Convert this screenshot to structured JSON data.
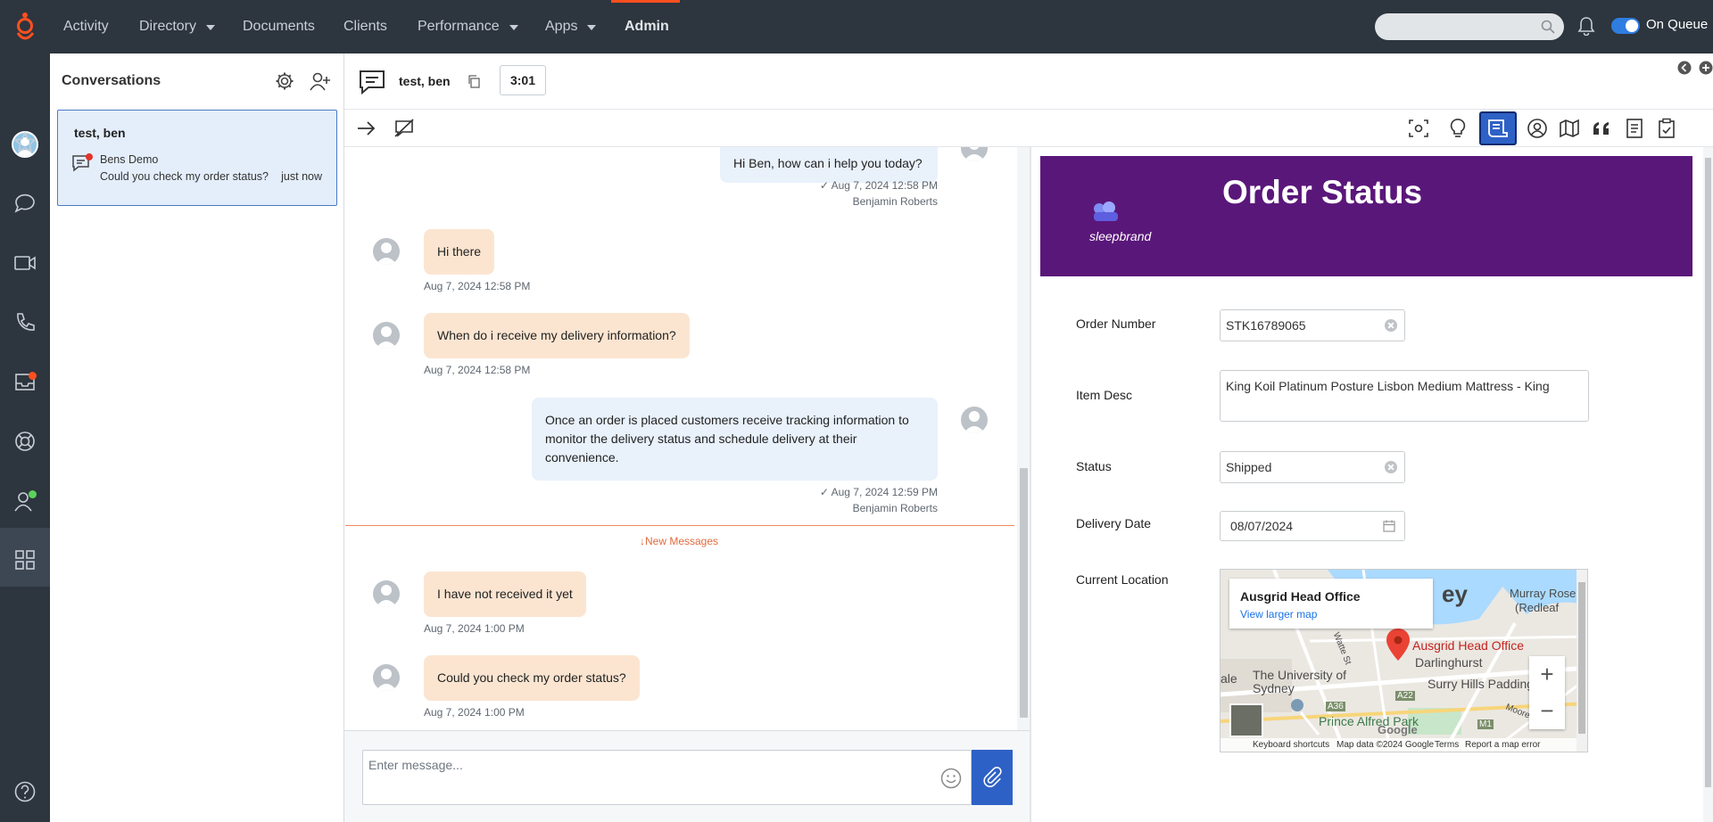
{
  "topbar": {
    "nav": [
      {
        "label": "Activity"
      },
      {
        "label": "Directory"
      },
      {
        "label": "Documents"
      },
      {
        "label": "Clients"
      },
      {
        "label": "Performance"
      },
      {
        "label": "Apps"
      },
      {
        "label": "Admin"
      }
    ],
    "search_placeholder": "",
    "queue_label": "On Queue",
    "accent_color": "#ff4f1f"
  },
  "rail": {
    "icons": [
      "avatar",
      "star-icon",
      "chat-bubble-icon",
      "video-icon",
      "phone-icon",
      "inbox-icon",
      "lifebuoy-icon",
      "user-status-icon",
      "apps-grid-icon",
      "help-icon"
    ]
  },
  "conversations": {
    "title": "Conversations",
    "items": [
      {
        "name": "test, ben",
        "queue": "Bens Demo",
        "preview": "Could you check my order status?",
        "time": "just now"
      }
    ]
  },
  "interaction": {
    "name": "test, ben",
    "timer": "3:01"
  },
  "transcript": {
    "messages": [
      {
        "from": "agent",
        "text": "Hi Ben, how can i help you today?",
        "time": "Aug 7, 2024 12:58 PM",
        "author": "Benjamin Roberts"
      },
      {
        "from": "customer",
        "text": "Hi there",
        "time": "Aug 7, 2024 12:58 PM"
      },
      {
        "from": "customer",
        "text": "When do i receive my delivery information?",
        "time": "Aug 7, 2024 12:58 PM"
      },
      {
        "from": "agent",
        "text": "Once an order is placed customers receive tracking information to monitor the delivery status and schedule delivery at their convenience.",
        "time": "Aug 7, 2024 12:59 PM",
        "author": "Benjamin Roberts"
      },
      {
        "from": "customer",
        "text": "I have not received it yet",
        "time": "Aug 7, 2024 1:00 PM"
      },
      {
        "from": "customer",
        "text": "Could you check my order status?",
        "time": "Aug 7, 2024 1:00 PM"
      }
    ],
    "new_messages_label": "New Messages"
  },
  "composer": {
    "placeholder": "Enter message..."
  },
  "script": {
    "banner_title": "Order Status",
    "brand_name": "sleepbrand",
    "banner_color": "#5a177a",
    "fields": {
      "order_number_label": "Order Number",
      "order_number": "STK16789065",
      "item_desc_label": "Item Desc",
      "item_desc": "King Koil Platinum Posture Lisbon Medium Mattress - King",
      "status_label": "Status",
      "status": "Shipped",
      "delivery_date_label": "Delivery Date",
      "delivery_date": "08/07/2024",
      "location_label": "Current Location"
    },
    "map": {
      "place_title": "Ausgrid Head Office",
      "view_larger": "View larger map",
      "labels": [
        "Ausgrid Head Office",
        "Darlinghurst",
        "The University of Sydney",
        "Surry Hills Paddingto",
        "Prince Alfred Park",
        "Murray Rose",
        "(Redleaf",
        "ey",
        "ale",
        "Watte St",
        "A22",
        "A36",
        "M1",
        "Moore Park"
      ],
      "google": "Google",
      "keyboard_shortcuts": "Keyboard shortcuts",
      "map_data": "Map data ©2024 Google",
      "terms": "Terms",
      "report": "Report a map error"
    }
  }
}
